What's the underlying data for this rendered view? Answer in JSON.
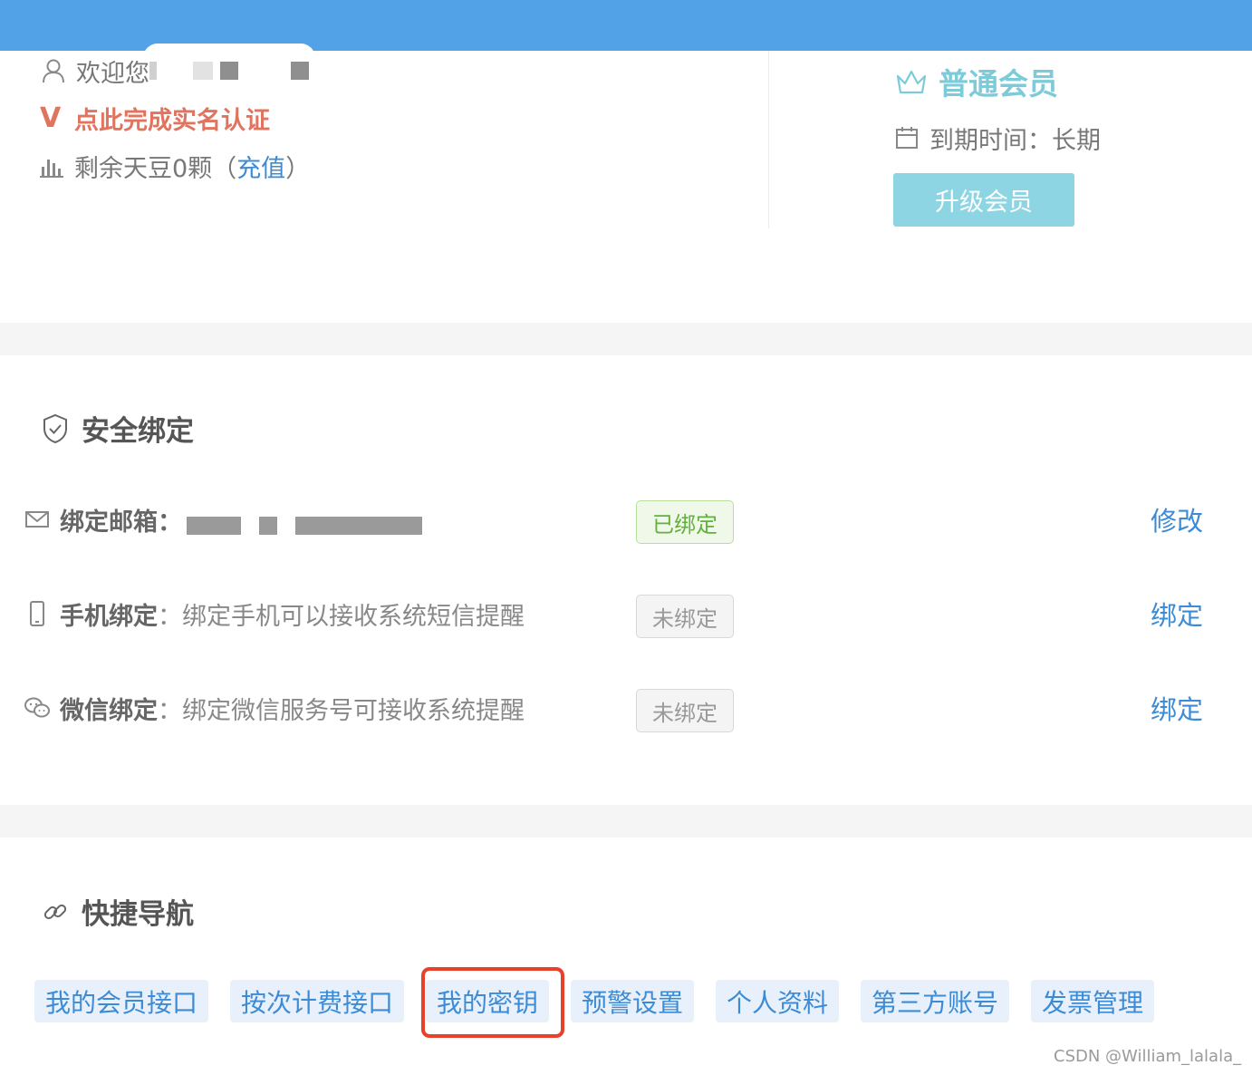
{
  "profile": {
    "welcome_text": "欢迎您",
    "verify_mark": "V",
    "verify_link": "点此完成实名认证",
    "beans_text": "剩余天豆0颗（",
    "recharge_link": "充值",
    "beans_close": "）"
  },
  "membership": {
    "tier": "普通会员",
    "expiry_label": "到期时间：",
    "expiry_value": "长期",
    "upgrade_button": "升级会员"
  },
  "security": {
    "title": "安全绑定",
    "email": {
      "label": "绑定邮箱：",
      "status": "已绑定",
      "action": "修改"
    },
    "phone": {
      "label": "手机绑定",
      "colon": "：",
      "description": "绑定手机可以接收系统短信提醒",
      "status": "未绑定",
      "action": "绑定"
    },
    "wechat": {
      "label": "微信绑定",
      "colon": "：",
      "description": "绑定微信服务号可接收系统提醒",
      "status": "未绑定",
      "action": "绑定"
    }
  },
  "quick_nav": {
    "title": "快捷导航",
    "items": [
      "我的会员接口",
      "按次计费接口",
      "我的密钥",
      "预警设置",
      "个人资料",
      "第三方账号",
      "发票管理"
    ]
  },
  "watermark": "CSDN @William_lalala_",
  "colors": {
    "top_bar": "#52a2e8",
    "link_blue": "#3d8bd4",
    "member_teal": "#7dcbd9",
    "verify_red": "#e0745f",
    "bound_green": "#60b23b",
    "highlight_red": "#e8402b"
  }
}
